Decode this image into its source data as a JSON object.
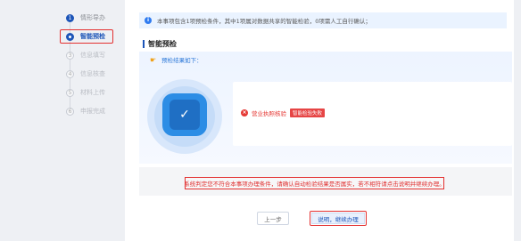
{
  "steps": [
    {
      "num": "1",
      "label": "情形导办",
      "state": "done"
    },
    {
      "num": "2",
      "label": "智能预检",
      "state": "active"
    },
    {
      "num": "3",
      "label": "信息填写",
      "state": "todo"
    },
    {
      "num": "4",
      "label": "信息核查",
      "state": "todo"
    },
    {
      "num": "5",
      "label": "材料上传",
      "state": "todo"
    },
    {
      "num": "6",
      "label": "申报完成",
      "state": "todo"
    }
  ],
  "notice": {
    "icon": "i",
    "text": "本事项包含1项预检条件，其中1项属对数据共享的智能检验，0项需人工自行确认；"
  },
  "section": {
    "title": "智能预检"
  },
  "result": {
    "heading": "预检结果如下：",
    "item_label": "营业执照核验",
    "item_badge": "智能检验失败"
  },
  "warning": {
    "text": "系统判定您不符合本事项办理条件，请确认自动检验结果是否属实，若不相符请点击说明并继续办理。"
  },
  "buttons": {
    "prev": "上一步",
    "next": "说明，继续办理"
  },
  "colors": {
    "primary": "#1d55b8",
    "alert": "#e33030",
    "accent": "#2c8de5"
  }
}
